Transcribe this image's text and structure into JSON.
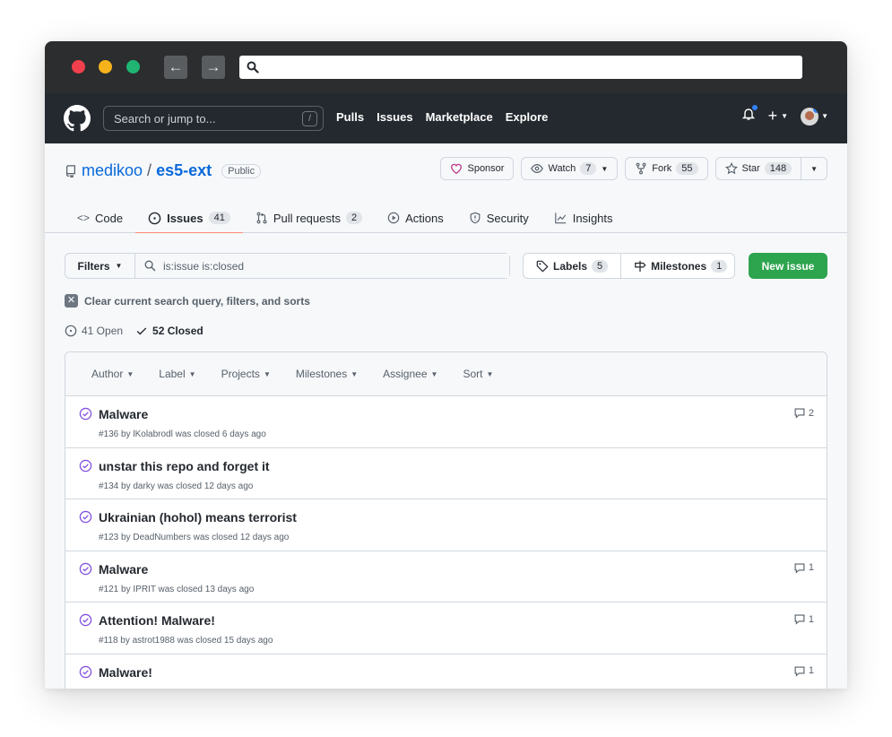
{
  "header": {
    "search_placeholder": "Search or jump to...",
    "search_shortcut": "/",
    "nav": [
      "Pulls",
      "Issues",
      "Marketplace",
      "Explore"
    ],
    "plus": "+"
  },
  "repo": {
    "owner": "medikoo",
    "separator": "/",
    "name": "es5-ext",
    "visibility": "Public",
    "sponsor_label": "Sponsor",
    "watch_label": "Watch",
    "watch_count": "7",
    "fork_label": "Fork",
    "fork_count": "55",
    "star_label": "Star",
    "star_count": "148"
  },
  "tabs": {
    "code": {
      "label": "Code"
    },
    "issues": {
      "label": "Issues",
      "count": "41"
    },
    "pulls": {
      "label": "Pull requests",
      "count": "2"
    },
    "actions": {
      "label": "Actions"
    },
    "security": {
      "label": "Security"
    },
    "insights": {
      "label": "Insights"
    }
  },
  "filters": {
    "button_label": "Filters",
    "query": "is:issue is:closed",
    "labels_label": "Labels",
    "labels_count": "5",
    "milestones_label": "Milestones",
    "milestones_count": "1",
    "new_issue_label": "New issue",
    "clear_label": "Clear current search query, filters, and sorts"
  },
  "states": {
    "open_label": "41 Open",
    "closed_label": "52 Closed"
  },
  "list_header": [
    "Author",
    "Label",
    "Projects",
    "Milestones",
    "Assignee",
    "Sort"
  ],
  "issues": [
    {
      "title": "Malware",
      "meta": "#136 by lKolabrodl was closed 6 days ago",
      "comments": "2"
    },
    {
      "title": "unstar this repo and forget it",
      "meta": "#134 by darky was closed 12 days ago",
      "comments": ""
    },
    {
      "title": "Ukrainian (hohol) means terrorist",
      "meta": "#123 by DeadNumbers was closed 12 days ago",
      "comments": ""
    },
    {
      "title": "Malware",
      "meta": "#121 by IPRIT was closed 13 days ago",
      "comments": "1"
    },
    {
      "title": "Attention! Malware!",
      "meta": "#118 by astrot1988 was closed 15 days ago",
      "comments": "1"
    },
    {
      "title": "Malware!",
      "meta": "",
      "comments": "1"
    }
  ],
  "colors": {
    "accent": "#0969da",
    "closed_icon": "#8250df",
    "new_issue": "#2da44e",
    "header_bg": "#24292f"
  }
}
